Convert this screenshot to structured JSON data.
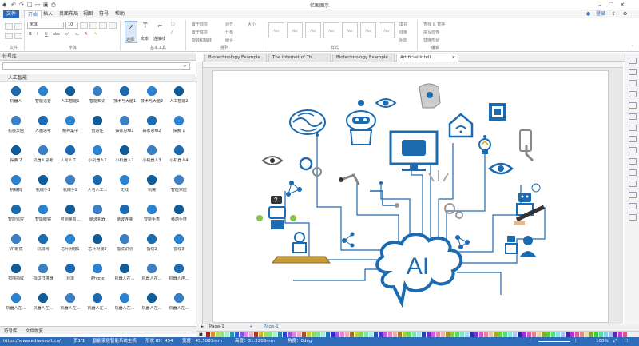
{
  "app": {
    "title": "亿图图示",
    "user": "登录"
  },
  "menu": {
    "tabs": [
      "文件",
      "开始",
      "插入",
      "页面布局",
      "视图",
      "符号",
      "帮助"
    ],
    "active": "开始"
  },
  "ribbon": {
    "sections": [
      "文件",
      "字体",
      "基本工具",
      "排列",
      "样式",
      "编辑"
    ],
    "font_name": "宋体",
    "font_size": "10",
    "tools": [
      "选择",
      "文本",
      "连接线"
    ],
    "arrange_items": [
      "置于顶层",
      "置于底层",
      "旋转和翻转",
      "组合",
      "对齐",
      "分布",
      "大小"
    ],
    "style_items": [
      "填充",
      "线条",
      "阴影"
    ],
    "edit_items": [
      "查找 & 替换",
      "拼写检查",
      "替换形状"
    ]
  },
  "library": {
    "header": "符号库",
    "category": "人工智能",
    "items": [
      "机器人",
      "智能语音",
      "人工智能1",
      "智能知识",
      "技术与大脑1",
      "技术与大脑2",
      "人工智能2",
      "机械大脑",
      "人脑思考",
      "精神集中",
      "创造性",
      "抽象思维1",
      "抽象思维2",
      "探索 1",
      "探索 2",
      "机器人思考",
      "人与人工...",
      "小机器人1",
      "小机器人2",
      "小机器人3",
      "小机器人4",
      "机械狗",
      "机械手1",
      "机械手2",
      "人与人工...",
      "无线",
      "机械",
      "智能家居",
      "智能监控",
      "智能眼镜",
      "可测量血...",
      "脑波机器",
      "脑波连接",
      "智能手表",
      "移动手环",
      "VR眼镜",
      "机械臂",
      "芯片对接1",
      "芯片对接2",
      "指纹识别",
      "指纹2",
      "指纹3",
      "扫描指纹",
      "指纹扫描器",
      "对准",
      "iPhone",
      "机器人在...",
      "机器人在...",
      "机器人连...",
      "机器人在...",
      "机器人在...",
      "机器人在...",
      "机器人在...",
      "机器人在...",
      "机器人在...",
      "机器人在..."
    ],
    "bottom_tabs": [
      "符号库",
      "文件恢复"
    ]
  },
  "documents": {
    "tabs": [
      "Biotechnology Example",
      "The Internet of Th...",
      "Biotechnology Example",
      "Artificial Intell..."
    ],
    "active": 3
  },
  "canvas": {
    "ai_text": "AI"
  },
  "pages": {
    "tab": "Page-1",
    "current": "Page-1"
  },
  "status": {
    "url": "https://www.edrawsoft.cn/",
    "page": "页1/1",
    "shape": "智能家居智能系统主机",
    "shape_id": "形状 ID：454",
    "width": "宽度：45.5083mm",
    "height": "高度：31.2208mm",
    "angle": "角度：0deg",
    "zoom": "100%"
  }
}
